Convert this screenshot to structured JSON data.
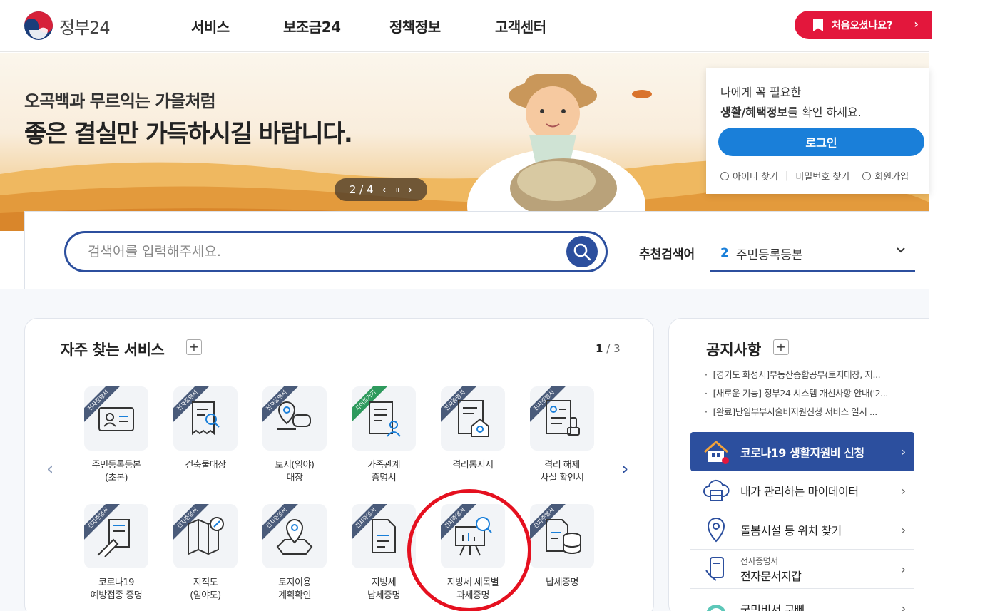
{
  "header": {
    "logo_text": "정부24",
    "nav": [
      "서비스",
      "보조금24",
      "정책정보",
      "고객센터"
    ],
    "first_visit_button": "처음오셨나요?",
    "first_visit_arrow": "›"
  },
  "banner": {
    "line1": "오곡백과 무르익는 가을처럼",
    "line2": "좋은 결실만 가득하시길 바랍니다.",
    "pager": {
      "current": "2",
      "separator": "/",
      "total": "4",
      "prev": "‹",
      "pause": "॥",
      "next": "›"
    }
  },
  "login_card": {
    "line1": "나에게 꼭 필요한",
    "line2_bold": "생활/혜택정보",
    "line2_rest": "를 확인 하세요.",
    "login_button": "로그인",
    "find_id": "아이디 찾기",
    "find_password": "비밀번호 찾기",
    "signup": "회원가입",
    "separator": "|"
  },
  "search": {
    "placeholder": "검색어를 입력해주세요.",
    "recommended_label": "추천검색어",
    "recommended_rank": "2",
    "recommended_term": "주민등록등본",
    "dropdown_icon": "chevron-down-icon"
  },
  "frequent_services": {
    "title": "자주 찾는 서비스",
    "plus": "+",
    "page_current": "1",
    "page_sep": "/",
    "page_total": "3",
    "prev_arrow": "‹",
    "next_arrow": "›",
    "items": [
      {
        "label": "주민등록등본\n(초본)",
        "ribbon": "전자증명서",
        "icon": "id-card-icon"
      },
      {
        "label": "건축물대장",
        "ribbon": "전자증명서",
        "icon": "document-search-icon"
      },
      {
        "label": "토지(임야)\n대장",
        "ribbon": "전자증명서",
        "icon": "map-pin-chat-icon"
      },
      {
        "label": "가족관계\n증명서",
        "ribbon": "사이트가기",
        "icon": "family-document-icon"
      },
      {
        "label": "격리통지서",
        "ribbon": "전자증명서",
        "icon": "quarantine-notice-icon"
      },
      {
        "label": "격리 해제\n사실 확인서",
        "ribbon": "전자증명서",
        "icon": "quarantine-release-icon"
      },
      {
        "label": "코로나19\n예방접종 증명",
        "ribbon": "전자증명서",
        "icon": "vaccine-icon"
      },
      {
        "label": "지적도\n(임야도)",
        "ribbon": "전자증명서",
        "icon": "cadastral-map-icon"
      },
      {
        "label": "토지이용\n계획확인",
        "ribbon": "전자증명서",
        "icon": "land-use-map-icon"
      },
      {
        "label": "지방세\n납세증명",
        "ribbon": "전자증명서",
        "icon": "tax-document-icon"
      },
      {
        "label": "지방세 세목별\n과세증명",
        "ribbon": "전자증명서",
        "icon": "chart-board-search-icon"
      },
      {
        "label": "납세증명",
        "ribbon": "전자증명서",
        "icon": "document-coins-icon"
      }
    ]
  },
  "notices": {
    "title": "공지사항",
    "plus": "+",
    "items": [
      "[경기도 화성시]부동산종합공부(토지대장, 지...",
      "[새로운 기능] 정부24 시스템 개선사항 안내('2...",
      "[완료]난임부부시술비지원신청 서비스 일시 ..."
    ]
  },
  "quick_links": {
    "covid": "코로나19 생활지원비 신청",
    "mydata": "내가 관리하는 마이데이터",
    "care": "돌봄시설 등 위치 찾기",
    "wallet_small": "전자증명서",
    "wallet": "전자문서지갑",
    "secretary": "국민비서 구삐",
    "arrow": "›"
  },
  "colors": {
    "brand_blue": "#2c4f9e",
    "login_blue": "#1a7fd9",
    "red": "#e3173c",
    "highlight_circle": "#e5101f"
  }
}
